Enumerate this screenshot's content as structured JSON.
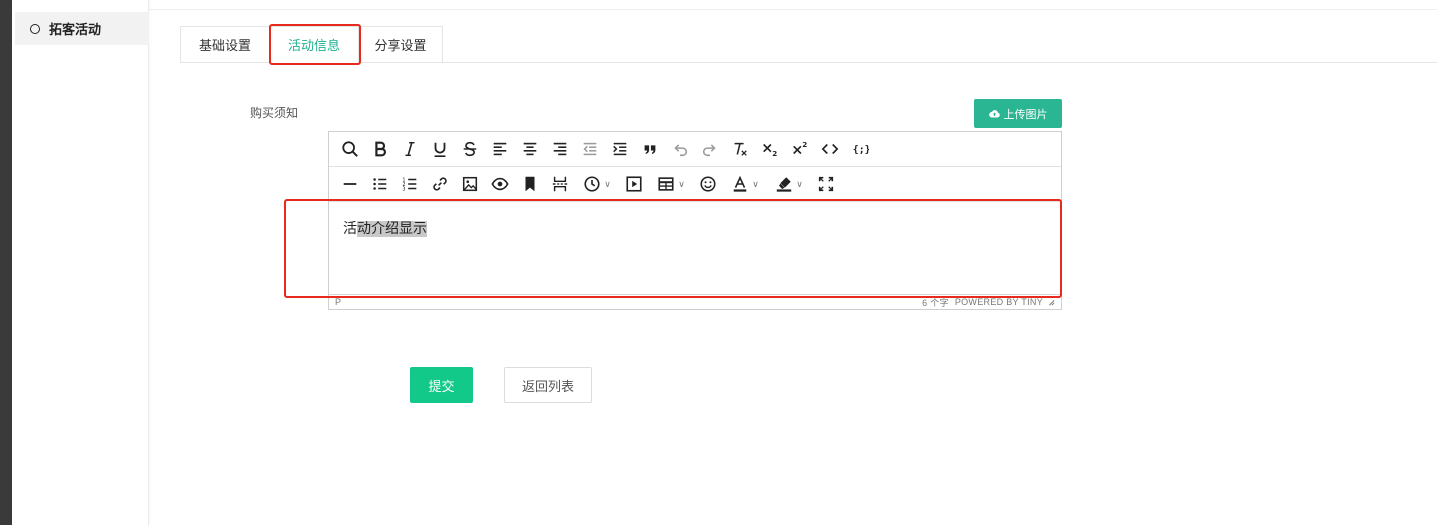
{
  "sidebar": {
    "items": [
      {
        "label": "拓客活动"
      }
    ]
  },
  "tabs": [
    {
      "label": "基础设置"
    },
    {
      "label": "活动信息"
    },
    {
      "label": "分享设置"
    }
  ],
  "form": {
    "field_label": "购买须知",
    "upload_label": "上传图片",
    "editor": {
      "content_plain": "活",
      "content_selected": "动介绍显示",
      "status_path": "P",
      "word_count": "6 个字",
      "powered_by": "POWERED BY TINY"
    },
    "submit_label": "提交",
    "back_label": "返回列表"
  },
  "colors": {
    "accent": "#20b08f",
    "submit": "#12c98a",
    "annotation": "#e8291e"
  }
}
